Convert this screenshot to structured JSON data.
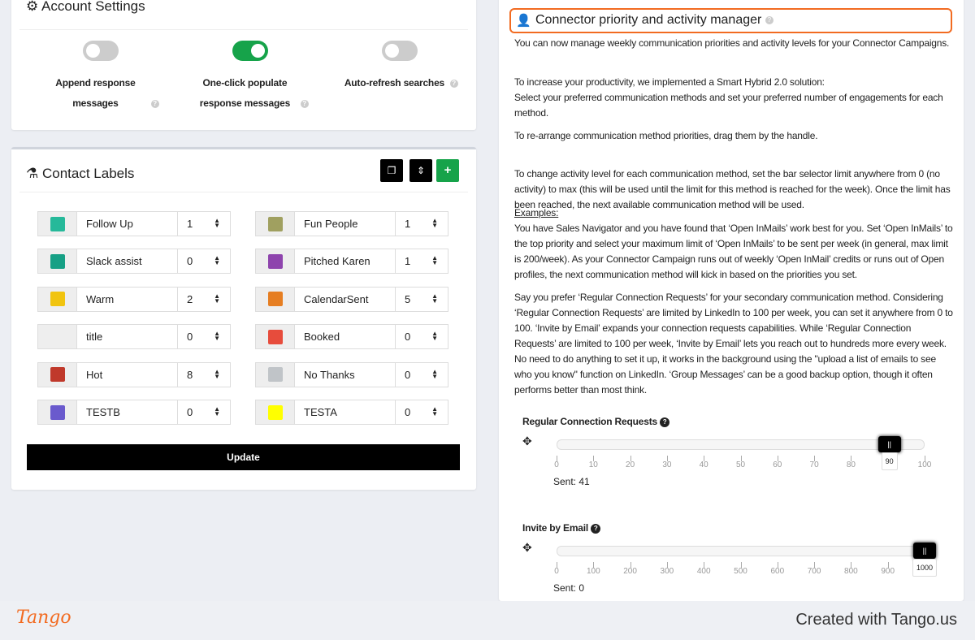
{
  "account_settings": {
    "title": "Account Settings",
    "toggles": [
      {
        "label": "Append response messages",
        "on": false
      },
      {
        "label": "One-click populate response messages",
        "on": true
      },
      {
        "label": "Auto-refresh searches",
        "on": false
      }
    ]
  },
  "contact_labels": {
    "title": "Contact Labels",
    "update_label": "Update",
    "add_label": "+",
    "left": [
      {
        "name": "Follow Up",
        "count": "1",
        "color": "#26b99a"
      },
      {
        "name": "Slack assist",
        "count": "0",
        "color": "#16a085"
      },
      {
        "name": "Warm",
        "count": "2",
        "color": "#f1c40f"
      },
      {
        "name": "title",
        "count": "0",
        "color": ""
      },
      {
        "name": "Hot",
        "count": "8",
        "color": "#c0392b"
      },
      {
        "name": "TESTB",
        "count": "0",
        "color": "#6a5acd"
      }
    ],
    "right": [
      {
        "name": "Fun People",
        "count": "1",
        "color": "#a0a060"
      },
      {
        "name": "Pitched Karen",
        "count": "1",
        "color": "#8e44ad"
      },
      {
        "name": "CalendarSent",
        "count": "5",
        "color": "#e67e22"
      },
      {
        "name": "Booked",
        "count": "0",
        "color": "#e74c3c"
      },
      {
        "name": "No Thanks",
        "count": "0",
        "color": "#c0c4c8"
      },
      {
        "name": "TESTA",
        "count": "0",
        "color": "#ffff00"
      }
    ]
  },
  "connector": {
    "title": "Connector priority and activity manager",
    "p1": "You can now manage weekly communication priorities and activity levels for your Connector Campaigns.",
    "p2": "To increase your productivity, we implemented a Smart Hybrid 2.0 solution:\nSelect your preferred communication methods and set your preferred number of engagements for each method.",
    "p3": "To re-arrange communication method priorities, drag them by the handle.",
    "p4": "To change activity level for each communication method, set the bar selector limit anywhere from 0 (no activity) to max (this will be used until the limit for this method is reached for the week). Once the limit has been reached, the next available communication method will be used.",
    "examples": "Examples:",
    "p5": "You have Sales Navigator and you have found that ‘Open InMails’ work best for you. Set ‘Open InMails’ to the top priority and select your maximum limit of ‘Open InMails’ to be sent per week (in general, max limit is 200/week). As your Connector Campaign runs out of weekly ‘Open InMail’ credits or runs out of Open profiles, the next communication method will kick in based on the priorities you set.",
    "p6": "Say you prefer ‘Regular Connection Requests’ for your secondary communication method. Considering ‘Regular Connection Requests’ are limited by LinkedIn to 100 per week, you can set it anywhere from 0 to 100. ‘Invite by Email’ expands your connection requests capabilities. While ‘Regular Connection Requests’ are limited to 100 per week, ‘Invite by Email’ lets you reach out to hundreds more every week. No need to do anything to set it up, it works in the background using the \"upload a list of emails to see who you know\" function on LinkedIn. ‘Group Messages’ can be a good backup option, though it often performs better than most think.",
    "sliders": [
      {
        "title": "Regular Connection Requests",
        "value": 90,
        "max": 100,
        "ticks": [
          "0",
          "10",
          "20",
          "30",
          "40",
          "50",
          "60",
          "70",
          "80",
          "90",
          "100"
        ],
        "sent": "Sent: 41"
      },
      {
        "title": "Invite by Email",
        "value": 1000,
        "max": 1000,
        "ticks": [
          "0",
          "100",
          "200",
          "300",
          "400",
          "500",
          "600",
          "700",
          "800",
          "900",
          "1000"
        ],
        "sent": "Sent: 0"
      }
    ]
  },
  "footer": {
    "logo": "Tango",
    "credit": "Created with Tango.us"
  },
  "colors": {
    "accent": "#16a34a",
    "highlight": "#f26b21"
  }
}
